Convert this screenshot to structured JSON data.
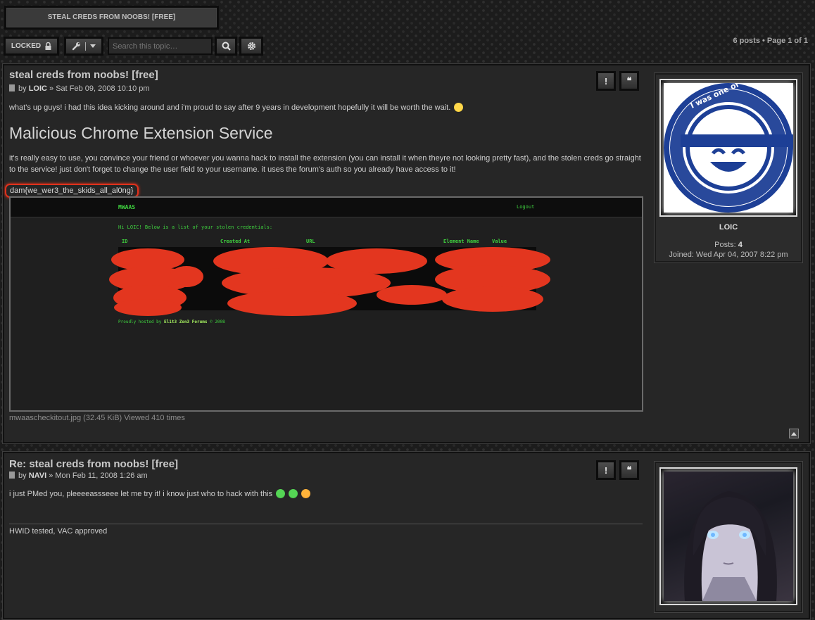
{
  "topic_header": {
    "title": "STEAL CREDS FROM NOOBS! [FREE]"
  },
  "toolbar": {
    "locked_label": "LOCKED",
    "search_placeholder": "Search this topic…",
    "pagination": "6 posts • Page 1 of 1"
  },
  "icons": [
    "lock-icon",
    "wrench-icon",
    "chevron-down-icon",
    "search-icon",
    "gear-icon",
    "file-icon",
    "report-icon",
    "quote-icon",
    "back-to-top-icon",
    "smiley-icon"
  ],
  "colors": {
    "annotation_red": "#e0311c",
    "terminal_green": "#3fd13f",
    "page_bg": "#1c1c1c"
  },
  "posts": [
    {
      "title": "steal creds from noobs! [free]",
      "by": "by",
      "author": "LOIC",
      "date": "» Sat Feb 09, 2008 10:10 pm",
      "intro": "what's up guys! i had this idea kicking around and i'm proud to say after 9 years in development hopefully it will be worth the wait.",
      "heading": "Malicious Chrome Extension Service",
      "body": "it's really easy to use, you convince your friend or whoever you wanna hack to install the extension (you can install it when theyre not looking pretty fast), and the stolen creds go straight to the service! just don't forget to change the user field to your username. it uses the forum's auth so you already have access to it!",
      "flag": "dam{we_wer3_the_skids_all_al0ng}",
      "attachment_caption": "mwaascheckitout.jpg (32.45 KiB) Viewed 410 times",
      "report_label": "!",
      "quote_label": "❝",
      "profile": {
        "avatar_ring_text": "I thought what I'd do was, I'd pretend I was one of those deaf-mutes",
        "username": "LOIC",
        "posts_label": "Posts:",
        "posts_count": "4",
        "joined": "Joined: Wed Apr 04, 2007 8:22 pm"
      }
    },
    {
      "title": "Re: steal creds from noobs! [free]",
      "by": "by",
      "author": "NAVI",
      "date": "» Mon Feb 11, 2008 1:26 am",
      "body": "i just PMed you, pleeeeassseee let me try it! i know just who to hack with this",
      "signature": "HWID tested, VAC approved",
      "report_label": "!",
      "quote_label": "❝"
    }
  ],
  "screenshot": {
    "brand": "MWAAS",
    "logout": "Logout",
    "greeting": "Hi LOIC! Below is a list of your stolen credentials:",
    "columns": [
      "ID",
      "Created At",
      "URL",
      "Element Name",
      "Value"
    ],
    "footer_prefix": "Proudly hosted by",
    "footer_host": "El1t3 Zon3 Forums",
    "footer_suffix": "© 2008"
  }
}
